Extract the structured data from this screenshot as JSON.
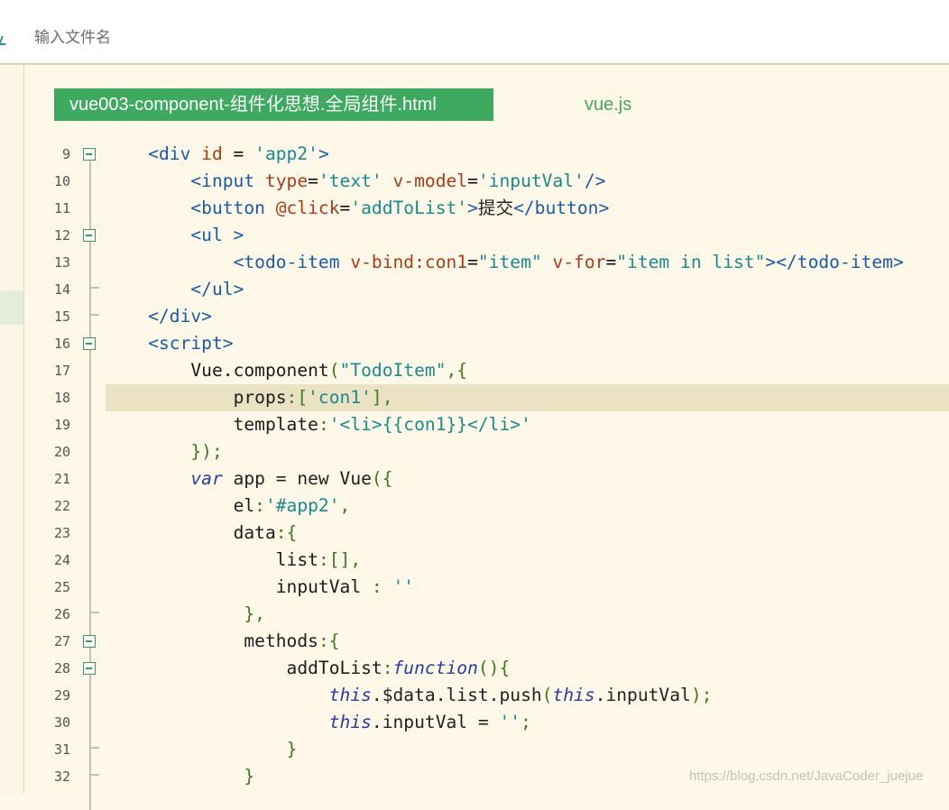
{
  "search": {
    "placeholder": "输入文件名"
  },
  "tabs": [
    {
      "label": "vue003-component-组件化思想.全局组件.html",
      "active": true
    },
    {
      "label": "vue.js",
      "active": false
    }
  ],
  "lines": [
    {
      "n": "9",
      "fold": true,
      "tokens": [
        [
          "    ",
          "t-plain"
        ],
        [
          "<",
          "t-tag"
        ],
        [
          "div",
          "t-tag"
        ],
        [
          " ",
          "t-plain"
        ],
        [
          "id",
          "t-attr"
        ],
        [
          " = ",
          "t-punc"
        ],
        [
          "'app2'",
          "t-str"
        ],
        [
          ">",
          "t-tag"
        ]
      ]
    },
    {
      "n": "10",
      "tokens": [
        [
          "        ",
          "t-plain"
        ],
        [
          "<",
          "t-tag"
        ],
        [
          "input",
          "t-tag"
        ],
        [
          " ",
          "t-plain"
        ],
        [
          "type",
          "t-attr"
        ],
        [
          "=",
          "t-punc"
        ],
        [
          "'text'",
          "t-str"
        ],
        [
          " ",
          "t-plain"
        ],
        [
          "v-model",
          "t-attr"
        ],
        [
          "=",
          "t-punc"
        ],
        [
          "'inputVal'",
          "t-str"
        ],
        [
          "/>",
          "t-tag"
        ]
      ]
    },
    {
      "n": "11",
      "tokens": [
        [
          "        ",
          "t-plain"
        ],
        [
          "<",
          "t-tag"
        ],
        [
          "button",
          "t-tag"
        ],
        [
          " ",
          "t-plain"
        ],
        [
          "@click",
          "t-attr"
        ],
        [
          "=",
          "t-punc"
        ],
        [
          "'addToList'",
          "t-str"
        ],
        [
          ">",
          "t-tag"
        ],
        [
          "提交",
          "t-plain"
        ],
        [
          "</",
          "t-tag"
        ],
        [
          "button",
          "t-tag"
        ],
        [
          ">",
          "t-tag"
        ]
      ]
    },
    {
      "n": "12",
      "fold": true,
      "tokens": [
        [
          "        ",
          "t-plain"
        ],
        [
          "<",
          "t-tag"
        ],
        [
          "ul",
          "t-tag"
        ],
        [
          " >",
          "t-tag"
        ]
      ]
    },
    {
      "n": "13",
      "tokens": [
        [
          "            ",
          "t-plain"
        ],
        [
          "<",
          "t-tag"
        ],
        [
          "todo-item",
          "t-tag"
        ],
        [
          " ",
          "t-plain"
        ],
        [
          "v-bind:con1",
          "t-attr"
        ],
        [
          "=",
          "t-punc"
        ],
        [
          "\"item\"",
          "t-str"
        ],
        [
          " ",
          "t-plain"
        ],
        [
          "v-for",
          "t-attr"
        ],
        [
          "=",
          "t-punc"
        ],
        [
          "\"item in list\"",
          "t-str"
        ],
        [
          "></",
          "t-tag"
        ],
        [
          "todo-item",
          "t-tag"
        ],
        [
          ">",
          "t-tag"
        ]
      ]
    },
    {
      "n": "14",
      "foldend": true,
      "tokens": [
        [
          "        ",
          "t-plain"
        ],
        [
          "</",
          "t-tag"
        ],
        [
          "ul",
          "t-tag"
        ],
        [
          ">",
          "t-tag"
        ]
      ]
    },
    {
      "n": "15",
      "foldend": true,
      "tokens": [
        [
          "    ",
          "t-plain"
        ],
        [
          "</",
          "t-tag"
        ],
        [
          "div",
          "t-tag"
        ],
        [
          ">",
          "t-tag"
        ]
      ]
    },
    {
      "n": "16",
      "fold": true,
      "tokens": [
        [
          "    ",
          "t-plain"
        ],
        [
          "<",
          "t-tag"
        ],
        [
          "script",
          "t-tag"
        ],
        [
          ">",
          "t-tag"
        ]
      ]
    },
    {
      "n": "17",
      "tokens": [
        [
          "        ",
          "t-plain"
        ],
        [
          "Vue",
          "t-prop"
        ],
        [
          ".",
          "t-punc"
        ],
        [
          "component",
          "t-prop"
        ],
        [
          "(",
          "t-green"
        ],
        [
          "\"TodoItem\"",
          "t-str"
        ],
        [
          ",{",
          "t-green"
        ]
      ]
    },
    {
      "n": "18",
      "hl": true,
      "tokens": [
        [
          "            ",
          "t-plain"
        ],
        [
          "props",
          "t-prop"
        ],
        [
          ":[",
          "t-green"
        ],
        [
          "'con1'",
          "t-str"
        ],
        [
          "],",
          "t-green"
        ]
      ]
    },
    {
      "n": "19",
      "tokens": [
        [
          "            ",
          "t-plain"
        ],
        [
          "template",
          "t-prop"
        ],
        [
          ":",
          "t-green"
        ],
        [
          "'<li>{{con1}}</li>'",
          "t-str"
        ]
      ]
    },
    {
      "n": "20",
      "tokens": [
        [
          "        ",
          "t-plain"
        ],
        [
          "});",
          "t-green"
        ]
      ]
    },
    {
      "n": "21",
      "tokens": [
        [
          "        ",
          "t-plain"
        ],
        [
          "var",
          "t-kw"
        ],
        [
          " app = ",
          "t-plain"
        ],
        [
          "new",
          "t-plain"
        ],
        [
          " Vue",
          "t-prop"
        ],
        [
          "({",
          "t-green"
        ]
      ]
    },
    {
      "n": "22",
      "tokens": [
        [
          "            ",
          "t-plain"
        ],
        [
          "el",
          "t-prop"
        ],
        [
          ":",
          "t-green"
        ],
        [
          "'#app2'",
          "t-str"
        ],
        [
          ",",
          "t-green"
        ]
      ]
    },
    {
      "n": "23",
      "tokens": [
        [
          "            ",
          "t-plain"
        ],
        [
          "data",
          "t-prop"
        ],
        [
          ":{",
          "t-green"
        ]
      ]
    },
    {
      "n": "24",
      "tokens": [
        [
          "                ",
          "t-plain"
        ],
        [
          "list",
          "t-prop"
        ],
        [
          ":[],",
          "t-green"
        ]
      ]
    },
    {
      "n": "25",
      "tokens": [
        [
          "                ",
          "t-plain"
        ],
        [
          "inputVal",
          "t-prop"
        ],
        [
          " : ",
          "t-green"
        ],
        [
          "''",
          "t-str"
        ]
      ]
    },
    {
      "n": "26",
      "foldend": true,
      "tokens": [
        [
          "             ",
          "t-plain"
        ],
        [
          "},",
          "t-green"
        ]
      ]
    },
    {
      "n": "27",
      "fold": true,
      "tokens": [
        [
          "             ",
          "t-plain"
        ],
        [
          "methods",
          "t-prop"
        ],
        [
          ":{",
          "t-green"
        ]
      ]
    },
    {
      "n": "28",
      "fold": true,
      "tokens": [
        [
          "                 ",
          "t-plain"
        ],
        [
          "addToList",
          "t-prop"
        ],
        [
          ":",
          "t-green"
        ],
        [
          "function",
          "t-fn"
        ],
        [
          "(){",
          "t-green"
        ]
      ]
    },
    {
      "n": "29",
      "tokens": [
        [
          "                     ",
          "t-plain"
        ],
        [
          "this",
          "t-kw"
        ],
        [
          ".$data.list.push",
          "t-plain"
        ],
        [
          "(",
          "t-green"
        ],
        [
          "this",
          "t-kw"
        ],
        [
          ".inputVal",
          ""
        ],
        [
          ");",
          "t-green"
        ]
      ]
    },
    {
      "n": "30",
      "tokens": [
        [
          "                     ",
          "t-plain"
        ],
        [
          "this",
          "t-kw"
        ],
        [
          ".inputVal = ",
          "t-plain"
        ],
        [
          "''",
          "t-str"
        ],
        [
          ";",
          "t-green"
        ]
      ]
    },
    {
      "n": "31",
      "foldend": true,
      "tokens": [
        [
          "                 ",
          "t-plain"
        ],
        [
          "}",
          "t-green"
        ]
      ]
    },
    {
      "n": "32",
      "foldend": true,
      "tokens": [
        [
          "             ",
          "t-plain"
        ],
        [
          "}",
          "t-green"
        ]
      ]
    }
  ],
  "watermark": "https://blog.csdn.net/JavaCoder_juejue"
}
